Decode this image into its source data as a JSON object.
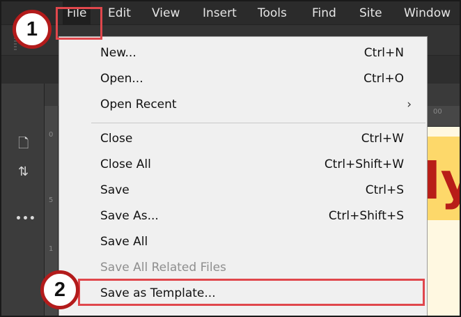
{
  "menubar": {
    "items": [
      {
        "label": "File"
      },
      {
        "label": "Edit"
      },
      {
        "label": "View"
      },
      {
        "label": "Insert"
      },
      {
        "label": "Tools"
      },
      {
        "label": "Find"
      },
      {
        "label": "Site"
      },
      {
        "label": "Window"
      }
    ]
  },
  "file_menu": {
    "items": [
      {
        "label": "New...",
        "shortcut": "Ctrl+N"
      },
      {
        "label": "Open...",
        "shortcut": "Ctrl+O"
      },
      {
        "label": "Open Recent",
        "submenu": "›"
      },
      {
        "label": "Close",
        "shortcut": "Ctrl+W"
      },
      {
        "label": "Close All",
        "shortcut": "Ctrl+Shift+W"
      },
      {
        "label": "Save",
        "shortcut": "Ctrl+S"
      },
      {
        "label": "Save As...",
        "shortcut": "Ctrl+Shift+S"
      },
      {
        "label": "Save All"
      },
      {
        "label": "Save All Related Files",
        "disabled": true
      },
      {
        "label": "Save as Template..."
      }
    ]
  },
  "callouts": {
    "step1": "1",
    "step2": "2"
  },
  "sidebar": {
    "icons": [
      "file-icon",
      "sort-arrows-icon",
      "more-icon"
    ],
    "glyphs": [
      "🗋",
      "⇅",
      "•••"
    ]
  },
  "document": {
    "visible_letters": "ly"
  },
  "rulers": {
    "h_tick": "00",
    "v_tick_0": "0",
    "v_tick_5": "5",
    "v_tick_10": "1"
  },
  "colors": {
    "accent_highlight": "#e0474c",
    "callout_border": "#b31b1b",
    "menubar_bg": "#2b2b2b",
    "menu_bg": "#f0f0f0",
    "doc_banner": "#fdd86a",
    "doc_text": "#b81d18"
  }
}
